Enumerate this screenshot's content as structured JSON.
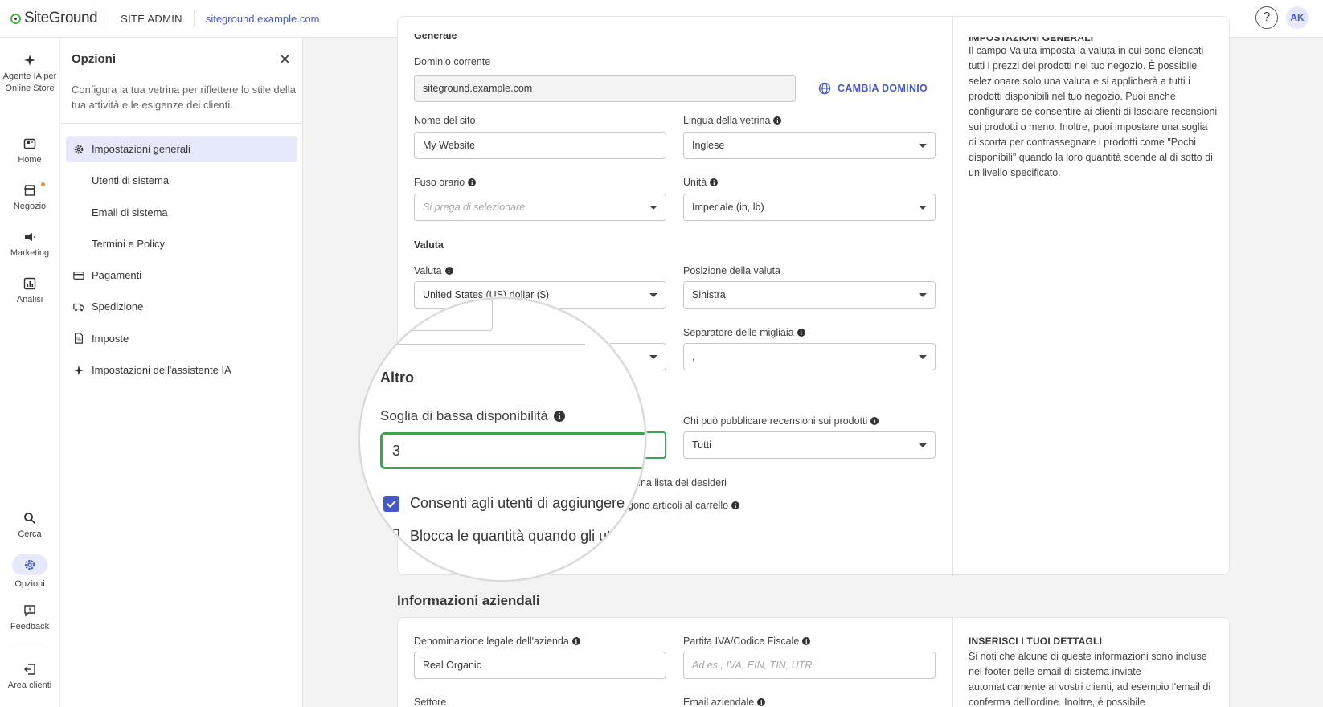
{
  "topbar": {
    "logo": "SiteGround",
    "section": "SITE ADMIN",
    "domain": "siteground.example.com",
    "help": "?",
    "avatar": "AK"
  },
  "leftnav": {
    "items": [
      {
        "label": "Agente IA per Online Store",
        "icon": "sparkle-icon"
      },
      {
        "label": "Home",
        "icon": "home-icon"
      },
      {
        "label": "Negozio",
        "icon": "store-icon"
      },
      {
        "label": "Marketing",
        "icon": "megaphone-icon"
      },
      {
        "label": "Analisi",
        "icon": "analytics-icon"
      },
      {
        "label": "Cerca",
        "icon": "search-icon"
      },
      {
        "label": "Opzioni",
        "icon": "gear-icon"
      },
      {
        "label": "Feedback",
        "icon": "feedback-icon"
      },
      {
        "label": "Area clienti",
        "icon": "exit-icon"
      }
    ]
  },
  "panel": {
    "title": "Opzioni",
    "description": "Configura la tua vetrina per riflettere lo stile della tua attività e le esigenze dei clienti.",
    "menu": [
      {
        "label": "Impostazioni generali",
        "icon": "gear-icon"
      },
      {
        "label": "Utenti di sistema"
      },
      {
        "label": "Email di sistema"
      },
      {
        "label": "Termini e Policy"
      },
      {
        "label": "Pagamenti",
        "icon": "card-icon"
      },
      {
        "label": "Spedizione",
        "icon": "truck-icon"
      },
      {
        "label": "Imposte",
        "icon": "tax-document-icon"
      },
      {
        "label": "Impostazioni dell'assistente IA",
        "icon": "sparkle-icon"
      }
    ]
  },
  "general": {
    "section_cut": "Generale",
    "current_domain_label": "Dominio corrente",
    "current_domain_value": "siteground.example.com",
    "change_domain": "CAMBIA DOMINIO",
    "site_name_label": "Nome del sito",
    "site_name_value": "My Website",
    "store_lang_label": "Lingua della vetrina",
    "store_lang_value": "Inglese",
    "timezone_label": "Fuso orario",
    "timezone_placeholder": "Si prega di selezionare",
    "units_label": "Unità",
    "units_value": "Imperiale (in, lb)",
    "currency_section": "Valuta",
    "currency_label": "Valuta",
    "currency_value": "United States (US) dollar ($)",
    "currency_pos_label": "Posizione della valuta",
    "currency_pos_value": "Sinistra",
    "thousands_label": "Separatore delle migliaia",
    "thousands_value": ",",
    "reviews_label": "Chi può pubblicare recensioni sui prodotti",
    "reviews_value": "Tutti",
    "wishlist_partial": "una lista dei desideri",
    "cart_partial": "gono articoli al carrello"
  },
  "side_info": {
    "heading_cut": "IMPOSTAZIONI GENERALI",
    "text": "Il campo Valuta imposta la valuta in cui sono elencati tutti i prezzi dei prodotti nel tuo negozio. È possibile selezionare solo una valuta e si applicherà a tutti i prodotti disponibili nel tuo negozio. Puoi anche configurare se consentire ai clienti di lasciare recensioni sui prodotti o meno. Inoltre, puoi impostare una soglia di scorta per contrassegnare i prodotti come \"Pochi disponibili\" quando la loro quantità scende al di sotto di un livello specificato."
  },
  "magnifier": {
    "section": "Altro",
    "low_stock_label": "Soglia di bassa disponibilità",
    "low_stock_value": "3",
    "wishlist_check": "Consenti agli utenti di aggiungere a",
    "lock_check": "Blocca le quantità quando gli ut"
  },
  "business": {
    "title": "Informazioni aziendali",
    "legal_name_label": "Denominazione legale dell'azienda",
    "legal_name_value": "Real Organic",
    "vat_label": "Partita IVA/Codice Fiscale",
    "vat_placeholder": "Ad es., IVA, EIN, TIN, UTR",
    "sector_label": "Settore",
    "email_label": "Email aziendale",
    "side_heading": "INSERISCI I TUOI DETTAGLI",
    "side_text": "Si noti che alcune di queste informazioni sono incluse nel footer delle email di sistema inviate automaticamente ai vostri clienti, ad esempio l'email di conferma dell'ordine. Inoltre, è possibile"
  },
  "colors": {
    "accent": "#4458c8",
    "active_bg": "#e6e8fb",
    "focus": "#3fa34d"
  }
}
